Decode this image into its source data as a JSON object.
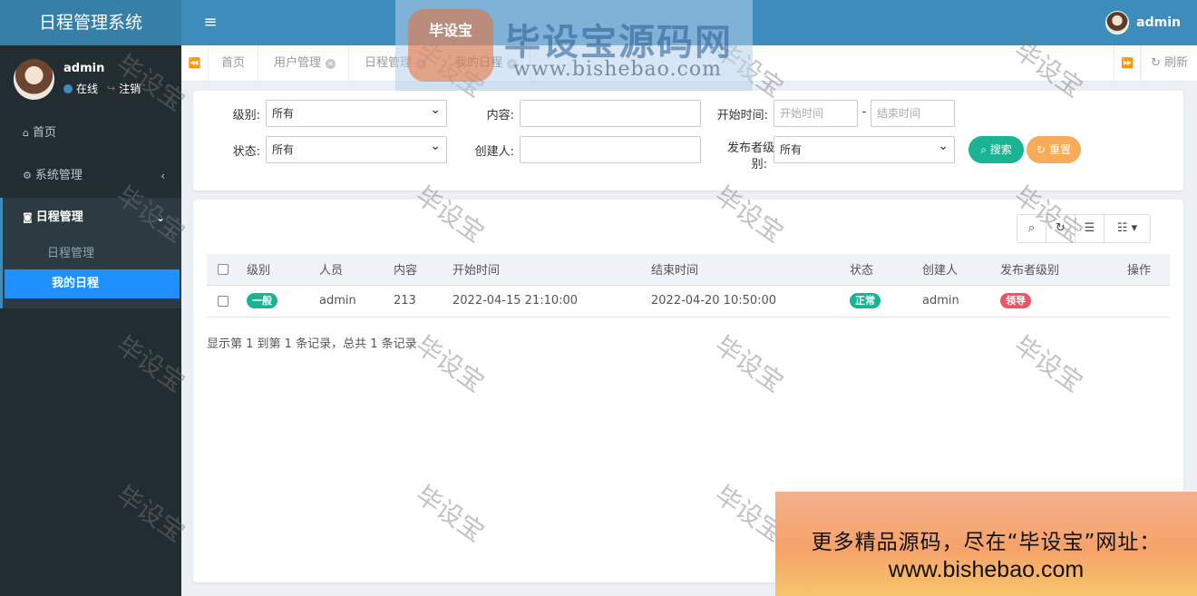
{
  "app": {
    "title": "日程管理系统",
    "menu_toggle": "≡"
  },
  "top_user": {
    "name": "admin"
  },
  "sidebar": {
    "user": {
      "name": "admin",
      "online": "在线",
      "logout": "注销"
    },
    "items": [
      {
        "icon": "home-icon",
        "label": "首页"
      },
      {
        "icon": "gear-icon",
        "label": "系统管理",
        "chevron": "‹"
      },
      {
        "icon": "binoculars-icon",
        "label": "日程管理",
        "chevron": "⌄"
      }
    ],
    "sub_items": [
      {
        "label": "日程管理"
      },
      {
        "label": "我的日程"
      }
    ]
  },
  "tabs": {
    "items": [
      {
        "label": "首页"
      },
      {
        "label": "用户管理"
      },
      {
        "label": "日程管理"
      },
      {
        "label": "我的日程"
      }
    ],
    "refresh": "刷新"
  },
  "search": {
    "level_label": "级别:",
    "level_value": "所有",
    "content_label": "内容:",
    "start_label": "开始时间:",
    "start_placeholder": "开始时间",
    "range_sep": "-",
    "end_placeholder": "结束时间",
    "status_label": "状态:",
    "status_value": "所有",
    "creator_label": "创建人:",
    "publisher_level_label_1": "发布者级",
    "publisher_level_label_2": "别:",
    "publisher_level_value": "所有",
    "search_button": "搜索",
    "reset_button": "重置"
  },
  "table": {
    "columns": [
      "级别",
      "人员",
      "内容",
      "开始时间",
      "结束时间",
      "状态",
      "创建人",
      "发布者级别",
      "操作"
    ],
    "rows": [
      {
        "level": "一般",
        "person": "admin",
        "content": "213",
        "start": "2022-04-15 21:10:00",
        "end": "2022-04-20 10:50:00",
        "status": "正常",
        "creator": "admin",
        "publisher_level": "领导",
        "actions": ""
      }
    ],
    "pagination": "显示第 1 到第 1 条记录，总共 1 条记录"
  },
  "watermark": {
    "text": "毕设宝",
    "logo_badge": "毕设宝",
    "logo_title": "毕设宝源码网",
    "logo_url": "www.bishebao.com"
  },
  "ad": {
    "line1": "更多精品源码，尽在“毕设宝”网址：",
    "line2": "www.bishebao.com"
  },
  "colors": {
    "header": "#3c8dbc",
    "logo_bg": "#367fa9",
    "sidebar": "#222d32",
    "active_item": "#1e90ff",
    "green": "#1ab394",
    "orange": "#f8ac59",
    "red": "#ed5565"
  }
}
